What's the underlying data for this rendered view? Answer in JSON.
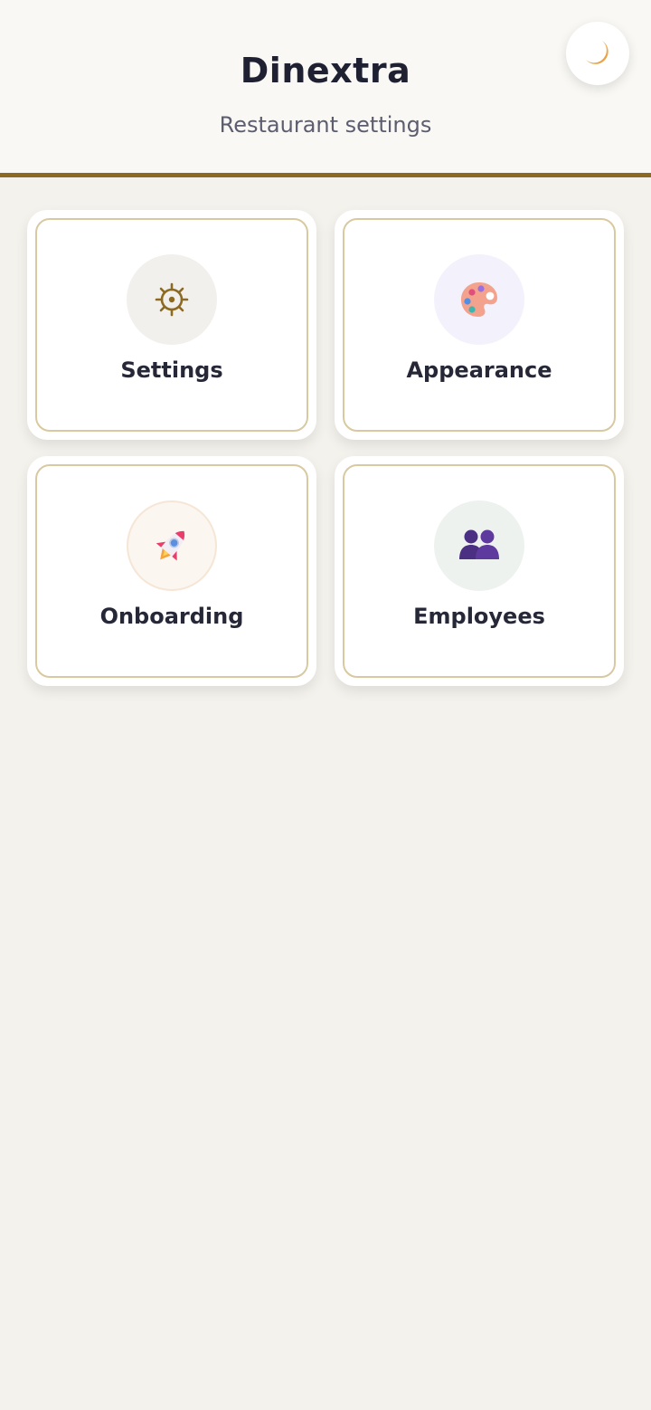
{
  "header": {
    "title": "Dinextra",
    "subtitle": "Restaurant settings",
    "theme_toggle_icon": "moon-icon"
  },
  "menu": [
    {
      "label": "Settings",
      "icon": "gear-icon",
      "circle_color": "#f1f0ec"
    },
    {
      "label": "Appearance",
      "icon": "palette-icon",
      "circle_color": "#f3f1fb"
    },
    {
      "label": "Onboarding",
      "icon": "rocket-icon",
      "circle_color": "#fbf6f0"
    },
    {
      "label": "Employees",
      "icon": "people-icon",
      "circle_color": "#eef2ef"
    }
  ],
  "colors": {
    "accent": "#8c6a22",
    "card_border": "#d8c9a0",
    "background": "#f4f2ec",
    "text_primary": "#1f2133"
  }
}
